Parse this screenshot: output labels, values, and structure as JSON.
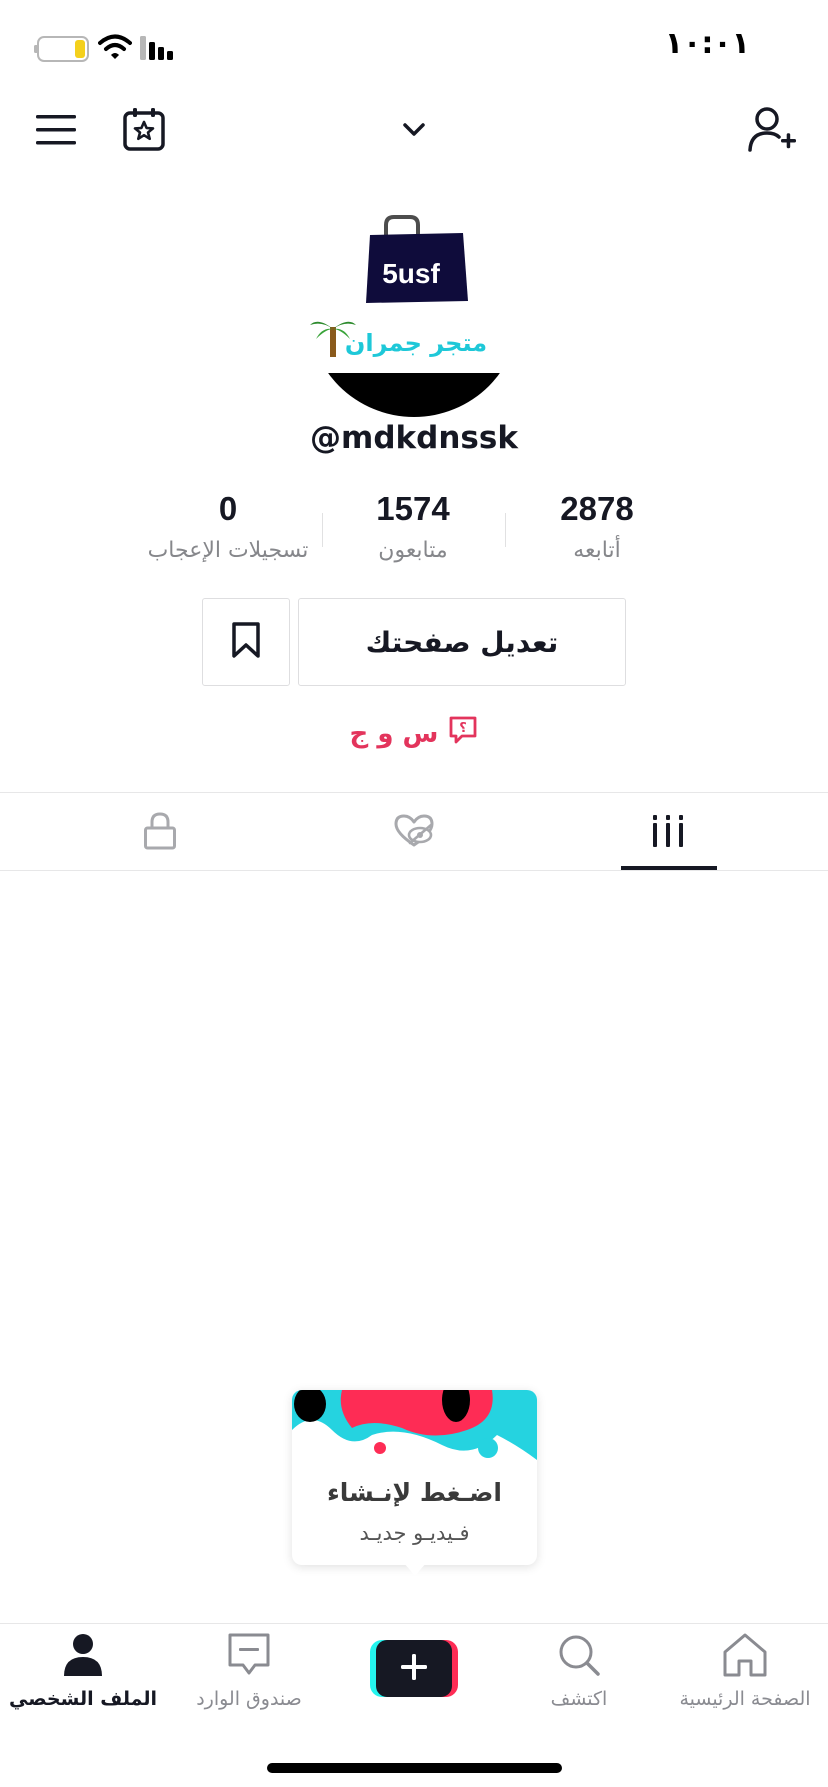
{
  "status_bar": {
    "time": "١٠:٠١",
    "battery_color": "#f4d01c"
  },
  "header": {
    "menu_icon": "hamburger-icon",
    "calendar_icon": "calendar-star-icon",
    "account_switch_icon": "chevron-down-icon",
    "add_friend_icon": "add-user-icon"
  },
  "profile": {
    "avatar_text": "5usf",
    "avatar_caption": "متجر جمران",
    "username": "@mdkdnssk",
    "stats": [
      {
        "value": "2878",
        "label": "أتابعه"
      },
      {
        "value": "1574",
        "label": "متابعون"
      },
      {
        "value": "0",
        "label": "تسجيلات الإعجاب"
      }
    ],
    "edit_button": "تعديل صفحتك",
    "save_icon": "bookmark-icon",
    "qa_label": "س و ج",
    "qa_icon": "question-bubble-icon"
  },
  "tabs": [
    {
      "name": "videos",
      "icon": "grid-icon",
      "active": true
    },
    {
      "name": "liked",
      "icon": "hidden-heart-icon",
      "active": false
    },
    {
      "name": "private",
      "icon": "lock-icon",
      "active": false
    }
  ],
  "tooltip": {
    "line1": "اضـغط لإنـشاء",
    "line2": "فـيديـو جديـد"
  },
  "bottom_nav": {
    "home": "الصفحة الرئيسية",
    "discover": "اكتشف",
    "inbox": "صندوق الوارد",
    "profile": "الملف الشخصي"
  },
  "colors": {
    "accent_red": "#fe2c55",
    "accent_cyan": "#25f4ee",
    "qa_color": "#e3345c",
    "text": "#161823"
  }
}
